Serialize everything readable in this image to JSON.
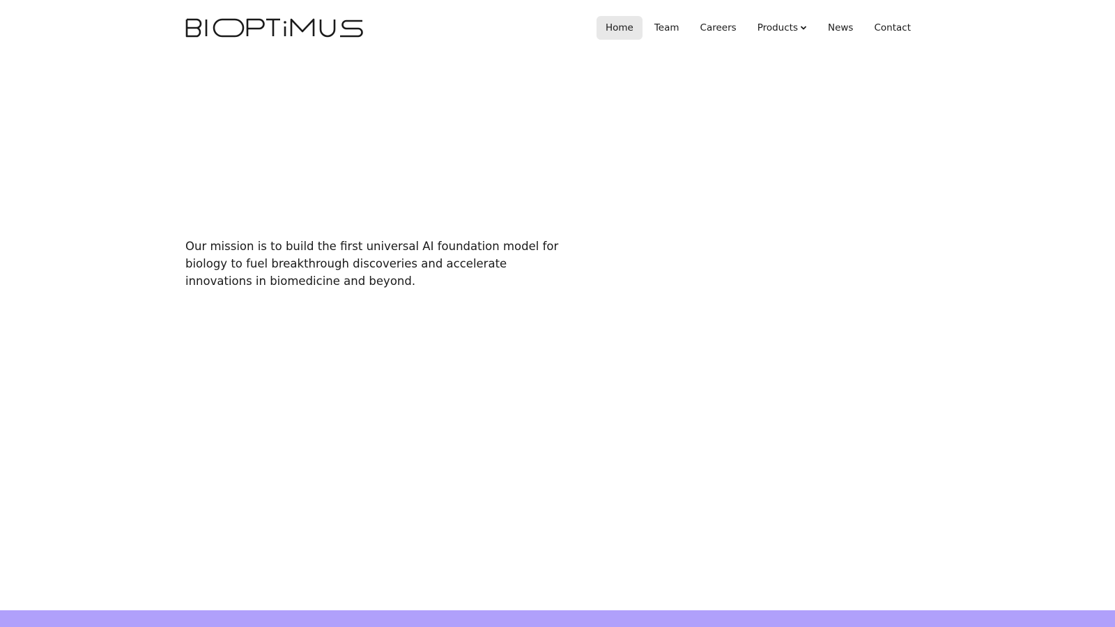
{
  "brand": {
    "name": "BIOPTIMUS"
  },
  "nav": {
    "items": [
      {
        "label": "Home",
        "active": true
      },
      {
        "label": "Team",
        "active": false
      },
      {
        "label": "Careers",
        "active": false
      },
      {
        "label": "Products",
        "active": false,
        "has_dropdown": true,
        "icon": "chevron-down-icon"
      },
      {
        "label": "News",
        "active": false
      },
      {
        "label": "Contact",
        "active": false
      }
    ]
  },
  "hero": {
    "mission": "Our mission is to build the first universal AI foundation model for biology to fuel breakthrough discoveries and accelerate innovations in biomedicine and beyond."
  },
  "colors": {
    "text": "#1a1a1a",
    "nav_active_bg": "#e8e8e8",
    "footer_band": "#b0a0fb",
    "background": "#ffffff"
  }
}
